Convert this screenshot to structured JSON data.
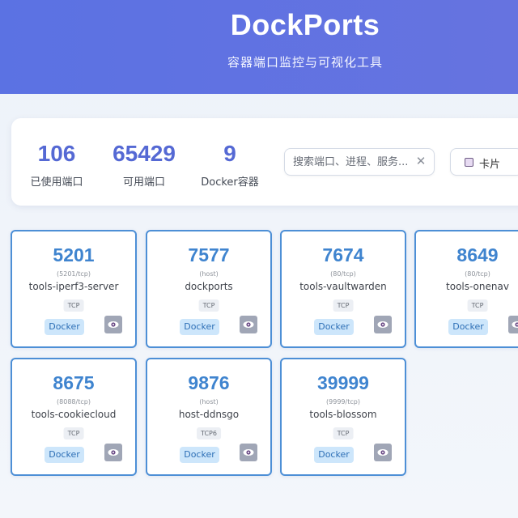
{
  "header": {
    "title": "DockPorts",
    "subtitle": "容器端口监控与可视化工具"
  },
  "stats": {
    "used_ports": "106",
    "used_ports_label": "已使用端口",
    "free_ports": "65429",
    "free_ports_label": "可用端口",
    "docker_containers": "9",
    "docker_containers_label": "Docker容器"
  },
  "search": {
    "placeholder": "搜索端口、进程、服务...",
    "value": "",
    "clear_icon": "close-icon"
  },
  "view_toggle": {
    "label": "卡片",
    "icon": "square-icon"
  },
  "colors": {
    "header_bg": "#5b72e3",
    "stat_value": "#5569d4",
    "card_border": "#4d8fd6",
    "port_number": "#3f84cf",
    "docker_badge_bg": "#cde6fb",
    "eye_button_bg": "#a0a6b6"
  },
  "cards": [
    {
      "port": "5201",
      "mapping": "(5201/tcp)",
      "name": "tools-iperf3-server",
      "protocol": "TCP",
      "type": "Docker",
      "action_icon": "eye-icon"
    },
    {
      "port": "7577",
      "mapping": "(host)",
      "name": "dockports",
      "protocol": "TCP",
      "type": "Docker",
      "action_icon": "eye-icon"
    },
    {
      "port": "7674",
      "mapping": "(80/tcp)",
      "name": "tools-vaultwarden",
      "protocol": "TCP",
      "type": "Docker",
      "action_icon": "eye-icon"
    },
    {
      "port": "8649",
      "mapping": "(80/tcp)",
      "name": "tools-onenav",
      "protocol": "TCP",
      "type": "Docker",
      "action_icon": "eye-icon"
    },
    {
      "port": "8675",
      "mapping": "(8088/tcp)",
      "name": "tools-cookiecloud",
      "protocol": "TCP",
      "type": "Docker",
      "action_icon": "eye-icon"
    },
    {
      "port": "9876",
      "mapping": "(host)",
      "name": "host-ddnsgo",
      "protocol": "TCP6",
      "type": "Docker",
      "action_icon": "eye-icon"
    },
    {
      "port": "39999",
      "mapping": "(9999/tcp)",
      "name": "tools-blossom",
      "protocol": "TCP",
      "type": "Docker",
      "action_icon": "eye-icon"
    }
  ]
}
